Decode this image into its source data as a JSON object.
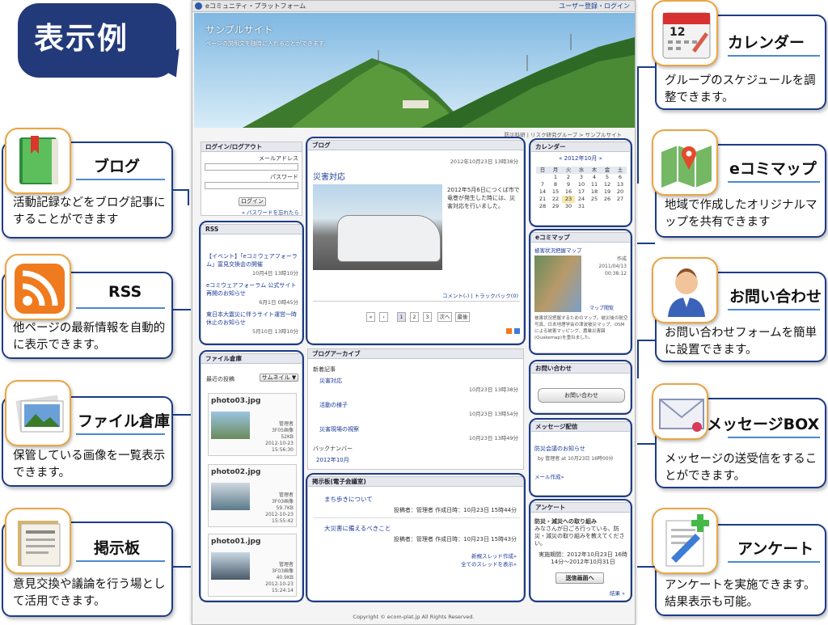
{
  "headline": "表示例",
  "features": [
    {
      "id": "blog",
      "title": "ブログ",
      "desc": "活動記録などをブログ記事にすることができます"
    },
    {
      "id": "rss",
      "title": "RSS",
      "desc": "他ページの最新情報を自動的に表示できます。"
    },
    {
      "id": "file",
      "title": "ファイル倉庫",
      "desc": "保管している画像を一覧表示できます。"
    },
    {
      "id": "bbs",
      "title": "掲示板",
      "desc": "意見交換や議論を行う場として活用できます。"
    },
    {
      "id": "calendar",
      "title": "カレンダー",
      "desc": "グループのスケジュールを調整できます。"
    },
    {
      "id": "map",
      "title": "eコミマップ",
      "desc": "地域で作成したオリジナルマップを共有できます"
    },
    {
      "id": "contact",
      "title": "お問い合わせ",
      "desc": "お問い合わせフォームを簡単に設置できます。"
    },
    {
      "id": "message",
      "title": "メッセージBOX",
      "desc": "メッセージの送受信をすることができます。"
    },
    {
      "id": "survey",
      "title": "アンケート",
      "desc": "アンケートを実施できます。結果表示も可能。"
    }
  ],
  "site": {
    "platform_title": "eコミュニティ・プラットフォーム",
    "top_links": "ユーザー登録・ログイン",
    "site_name": "サンプルサイト",
    "site_desc": "ページの説明文を随時に入れることができます。",
    "breadcrumb": "防災科研 | リスク研究グループ > サンプルサイト",
    "login": {
      "title": "ログイン/ログアウト",
      "email_label": "メールアドレス",
      "password_label": "パスワード",
      "button": "ログイン",
      "forgot": "» パスワードを忘れたら"
    },
    "rss": {
      "title": "RSS",
      "items": [
        {
          "text": "【イベント】「eコミウェアフォーラム」富見交換会の開催",
          "date": "10月4日 13時10分"
        },
        {
          "text": "eコミウェアフォーラム 公式サイト再開のお知らせ",
          "date": "6月1日 0時45分"
        },
        {
          "text": "東日本大震災に伴うサイト運営一時休止のお知らせ",
          "date": "5月10日 13時10分"
        }
      ]
    },
    "files": {
      "title": "ファイル倉庫",
      "subtitle": "最近の投稿",
      "view": "サムネイル ▼",
      "items": [
        {
          "name": "photo03.jpg",
          "meta": [
            "管理者",
            "3F05画像",
            "52KB",
            "2012-10-23",
            "15:56:30"
          ]
        },
        {
          "name": "photo02.jpg",
          "meta": [
            "管理者",
            "3F03画像",
            "59.7KB",
            "2012-10-23",
            "15:55:42"
          ]
        },
        {
          "name": "photo01.jpg",
          "meta": [
            "管理者",
            "3F03画像",
            "40.9KB",
            "2012-10-23",
            "15:24:14"
          ]
        }
      ]
    },
    "blog": {
      "title": "ブログ",
      "date": "2012年10月23日 13時38分",
      "post_title": "災害対応",
      "body": "2012年5月6日につくば市で竜巻が発生した時には、災害対応を行いました。",
      "comments": "コメント(-) | トラックバック(0)",
      "pages": [
        "«",
        "‹",
        "1",
        "2",
        "3",
        "次へ",
        "最後"
      ]
    },
    "archive": {
      "title": "ブログアーカイブ",
      "latest": "新着記事",
      "posts": [
        {
          "title": "災害対応",
          "date": "10月23日 13時38分"
        },
        {
          "title": "活動の様子",
          "date": "10月23日 13時54分"
        },
        {
          "title": "災害現場の視察",
          "date": "10月23日 13時49分"
        }
      ],
      "backnumber": "バックナンバー",
      "month": "2012年10月"
    },
    "bbs": {
      "title": "掲示板(電子会議室)",
      "threads": [
        {
          "title": "まち歩きについて",
          "meta": "投稿者：管理者 作成日時：10月23日 15時44分"
        },
        {
          "title": "大災害に備えるべきこと",
          "meta": "投稿者：管理者 作成日時：10月23日 15時43分"
        }
      ],
      "new_thread": "新規スレッド作成»",
      "all_threads": "全てのスレッドを表示»"
    },
    "calendar": {
      "title": "カレンダー",
      "month_label": "« 2012年10月 »",
      "weekdays": [
        "日",
        "月",
        "火",
        "水",
        "木",
        "金",
        "土"
      ],
      "weeks": [
        [
          "",
          "1",
          "2",
          "3",
          "4",
          "5",
          "6"
        ],
        [
          "7",
          "8",
          "9",
          "10",
          "11",
          "12",
          "13"
        ],
        [
          "14",
          "15",
          "16",
          "17",
          "18",
          "19",
          "20"
        ],
        [
          "21",
          "22",
          "23",
          "24",
          "25",
          "26",
          "27"
        ],
        [
          "28",
          "29",
          "30",
          "31",
          "",
          "",
          ""
        ]
      ]
    },
    "ecomap": {
      "title": "eコミマップ",
      "map_title": "被害状況把握マップ",
      "author": "作成",
      "date": "2011/04/13",
      "time": "00:38:12",
      "desc": "被害状況把握するためのマップ。被災後の航空写真、日本地理学会の津波被災マップ、OSMによる被害マッピング、農業災害図(Quakemap)を重ねました。",
      "link": "マップ閲覧"
    },
    "contact": {
      "title": "お問い合わせ",
      "button": "お問い合わせ"
    },
    "message": {
      "title": "メッセージ配信",
      "item": "防災会議のお知らせ",
      "meta": "by 管理者 at 10月23日 16時00分",
      "link": "メール作成»"
    },
    "survey": {
      "title": "アンケート",
      "q_title": "防災・減災への取り組み",
      "q_body": "みなさんが日ごろ行っている、防災・減災の取り組みを教えてください。",
      "period": "実施期間：2012年10月23日 16時14分～2012年10月31日",
      "button": "送信画面へ",
      "result": "結果 »"
    },
    "footer": "Copyright © ecom-plat.jp All Rights Reserved."
  }
}
